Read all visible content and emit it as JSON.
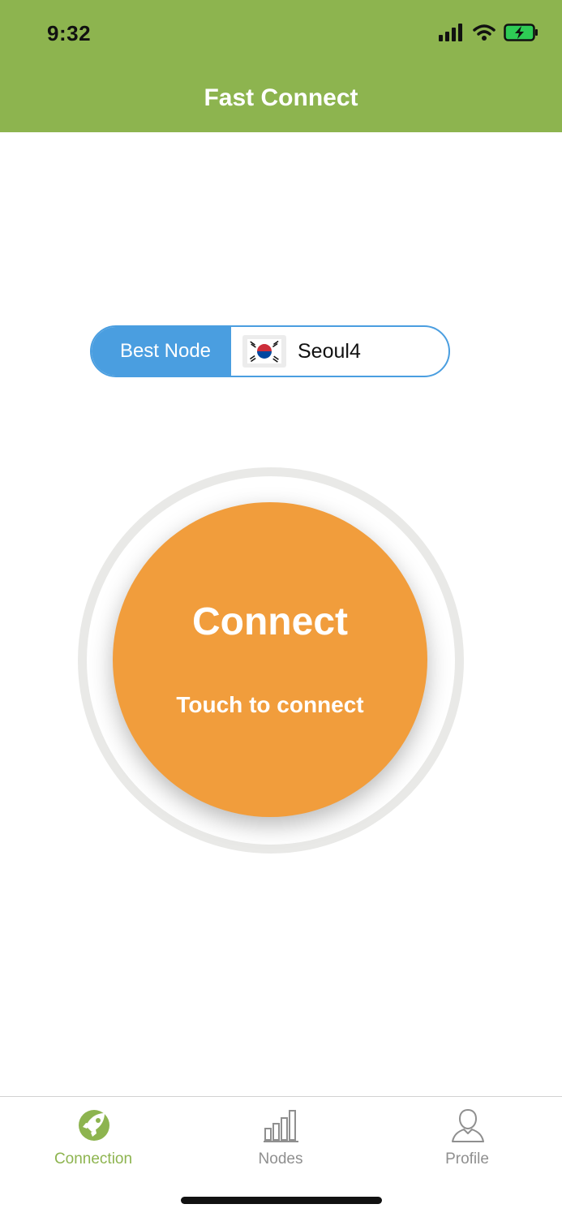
{
  "status_bar": {
    "time": "9:32"
  },
  "header": {
    "title": "Fast Connect"
  },
  "node_selector": {
    "label": "Best Node",
    "flag_icon": "south-korea-flag",
    "node_name": "Seoul4"
  },
  "connect": {
    "title": "Connect",
    "subtitle": "Touch to connect"
  },
  "tabbar": {
    "tabs": [
      {
        "label": "Connection",
        "icon": "rocket-icon",
        "active": true
      },
      {
        "label": "Nodes",
        "icon": "signal-bars-icon",
        "active": false
      },
      {
        "label": "Profile",
        "icon": "user-icon",
        "active": false
      }
    ]
  },
  "colors": {
    "header": "#8db44f",
    "accent_blue": "#4a9ee0",
    "connect_orange": "#f19d3c",
    "active_tab": "#8db44f",
    "inactive_tab": "#8f8f8f"
  }
}
